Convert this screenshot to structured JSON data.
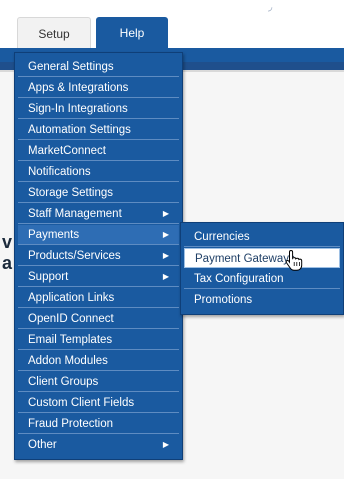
{
  "tabs": [
    {
      "label": "Setup"
    },
    {
      "label": "Help"
    }
  ],
  "edge_fragments": [
    "v",
    "a"
  ],
  "menu": {
    "items": [
      {
        "label": "General Settings",
        "has_submenu": false
      },
      {
        "label": "Apps & Integrations",
        "has_submenu": false
      },
      {
        "label": "Sign-In Integrations",
        "has_submenu": false
      },
      {
        "label": "Automation Settings",
        "has_submenu": false
      },
      {
        "label": "MarketConnect",
        "has_submenu": false
      },
      {
        "label": "Notifications",
        "has_submenu": false
      },
      {
        "label": "Storage Settings",
        "has_submenu": false
      },
      {
        "label": "Staff Management",
        "has_submenu": true
      },
      {
        "label": "Payments",
        "has_submenu": true
      },
      {
        "label": "Products/Services",
        "has_submenu": true
      },
      {
        "label": "Support",
        "has_submenu": true
      },
      {
        "label": "Application Links",
        "has_submenu": false
      },
      {
        "label": "OpenID Connect",
        "has_submenu": false
      },
      {
        "label": "Email Templates",
        "has_submenu": false
      },
      {
        "label": "Addon Modules",
        "has_submenu": false
      },
      {
        "label": "Client Groups",
        "has_submenu": false
      },
      {
        "label": "Custom Client Fields",
        "has_submenu": false
      },
      {
        "label": "Fraud Protection",
        "has_submenu": false
      },
      {
        "label": "Other",
        "has_submenu": true
      }
    ]
  },
  "submenu": {
    "items": [
      {
        "label": "Currencies"
      },
      {
        "label": "Payment Gateways"
      },
      {
        "label": "Tax Configuration"
      },
      {
        "label": "Promotions"
      }
    ]
  },
  "colors": {
    "menu_bg": "#1a5aa0",
    "highlight_bg": "#ffffff",
    "separator": "#5e8cc2"
  }
}
